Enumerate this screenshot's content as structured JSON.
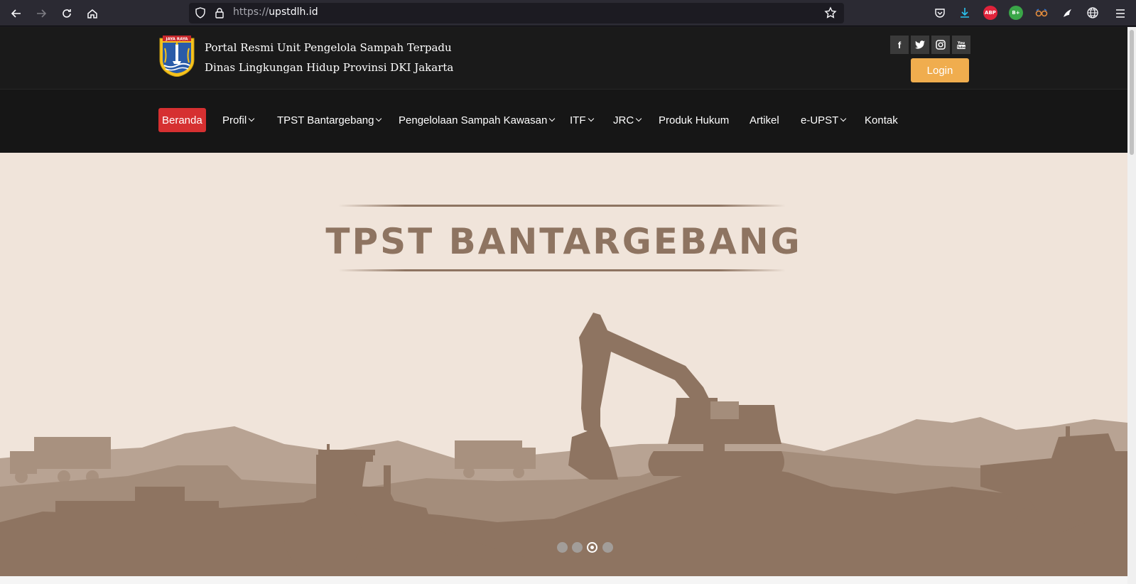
{
  "browser": {
    "url_scheme": "https://",
    "url_host": "upstdlh.id",
    "extensions": [
      {
        "name": "pocket-icon",
        "label": ""
      },
      {
        "name": "download-icon",
        "label": ""
      },
      {
        "name": "adblock-plus-icon",
        "label": "ABP"
      },
      {
        "name": "bplus-extension-icon",
        "label": "B+"
      },
      {
        "name": "glasses-extension-icon",
        "label": ""
      },
      {
        "name": "bird-extension-icon",
        "label": ""
      },
      {
        "name": "globe-extension-icon",
        "label": ""
      }
    ]
  },
  "header": {
    "title_line1": "Portal Resmi Unit Pengelola Sampah Terpadu",
    "title_line2": "Dinas Lingkungan Hidup Provinsi DKI Jakarta",
    "logo_banner": "JAYA RAYA",
    "social": [
      {
        "name": "facebook-icon",
        "glyph": "f"
      },
      {
        "name": "twitter-icon",
        "glyph": "t"
      },
      {
        "name": "instagram-icon",
        "glyph": "◎"
      },
      {
        "name": "youtube-icon",
        "glyph": "▶"
      }
    ],
    "login_label": "Login"
  },
  "nav": {
    "items": [
      {
        "label": "Beranda",
        "dropdown": false,
        "active": true
      },
      {
        "label": "Profil",
        "dropdown": true
      },
      {
        "label": "TPST Bantargebang",
        "dropdown": true
      },
      {
        "label": "Pengelolaan Sampah Kawasan",
        "dropdown": true
      },
      {
        "label": "ITF",
        "dropdown": true
      },
      {
        "label": "JRC",
        "dropdown": true
      },
      {
        "label": "Produk Hukum",
        "dropdown": false
      },
      {
        "label": "Artikel",
        "dropdown": false
      },
      {
        "label": "e-UPST",
        "dropdown": true
      },
      {
        "label": "Kontak",
        "dropdown": false
      }
    ]
  },
  "hero": {
    "title": "TPST BANTARGEBANG",
    "slides_total": 4,
    "active_slide": 3
  },
  "colors": {
    "accent_red": "#d63031",
    "login_orange": "#f0ad4e",
    "hero_bg": "#f0e4da",
    "hero_brown": "#8e7461"
  }
}
